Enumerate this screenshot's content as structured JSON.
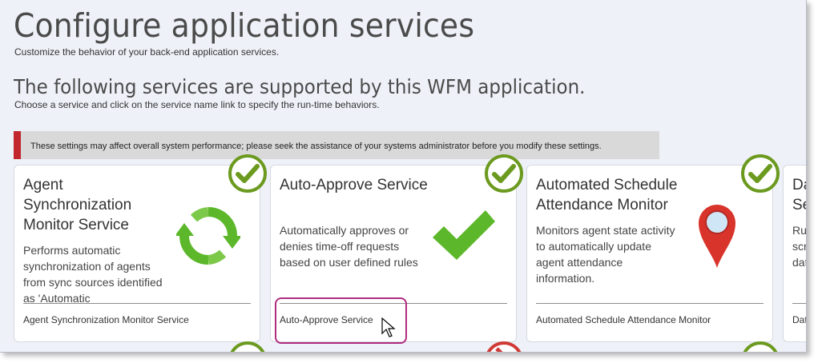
{
  "page": {
    "title": "Configure application services",
    "subtitle": "Customize the behavior of your back-end application services.",
    "section_title": "The following services are supported by this WFM application.",
    "section_subtitle": "Choose a service and click on the service name link to specify the run-time behaviors."
  },
  "alert": {
    "text": "These settings may affect overall system performance; please seek the assistance of your systems administrator before you modify these settings.",
    "color": "#c1272d"
  },
  "cards": [
    {
      "title": "Agent Synchronization Monitor Service",
      "description": "Performs automatic synchronization of agents from sync sources identified as 'Automatic",
      "link": "Agent Synchronization Monitor Service",
      "icon": "sync-arrows-icon",
      "status": "enabled-check-icon"
    },
    {
      "title": "Auto-Approve Service",
      "description": "Automatically approves or denies time-off requests based on user defined rules",
      "link": "Auto-Approve Service",
      "icon": "checkmark-icon",
      "status": "enabled-check-icon"
    },
    {
      "title": "Automated Schedule Attendance Monitor",
      "description": "Monitors agent state activity to automatically update agent attendance information.",
      "link": "Automated Schedule Attendance Monitor",
      "icon": "map-pin-icon",
      "status": "enabled-check-icon"
    },
    {
      "title": "Da Se",
      "description": "Ru scri dat",
      "link": "Dat",
      "icon": "",
      "status": ""
    }
  ],
  "colors": {
    "status_green": "#6b9a1f",
    "icon_green": "#5cb82a",
    "pin_red": "#d9342b",
    "highlight": "#b12b7f",
    "status_red": "#d03a35"
  }
}
